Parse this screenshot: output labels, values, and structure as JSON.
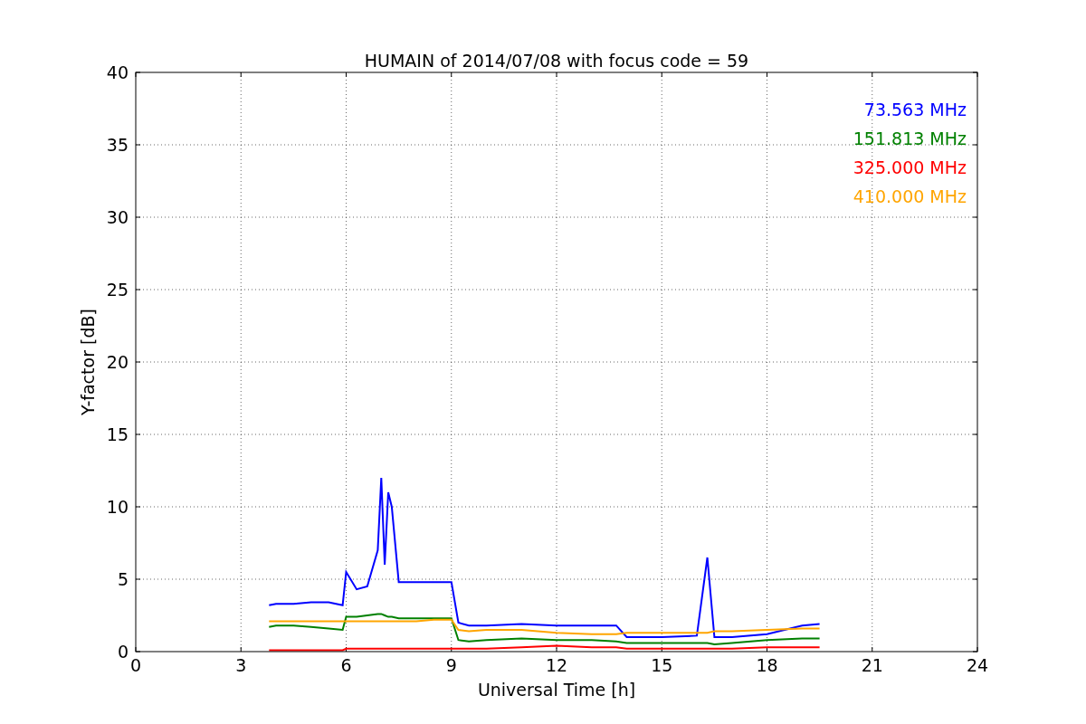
{
  "chart_data": {
    "type": "line",
    "title": "HUMAIN of 2014/07/08 with focus code = 59",
    "xlabel": "Universal Time [h]",
    "ylabel": "Y-factor [dB]",
    "xlim": [
      0,
      24
    ],
    "ylim": [
      0,
      40
    ],
    "grid": true,
    "xticks": [
      0,
      3,
      6,
      9,
      12,
      15,
      18,
      21,
      24
    ],
    "yticks": [
      0,
      5,
      10,
      15,
      20,
      25,
      30,
      35,
      40
    ],
    "x": [
      3.8,
      4,
      4.5,
      5,
      5.5,
      5.9,
      6.0,
      6.3,
      6.6,
      6.9,
      7.0,
      7.1,
      7.2,
      7.3,
      7.5,
      8,
      8.5,
      9,
      9.2,
      9.5,
      10,
      11,
      12,
      13,
      13.7,
      14,
      15,
      16,
      16.3,
      16.5,
      17,
      18,
      19,
      19.5
    ],
    "series": [
      {
        "name": "73.563 MHz",
        "color": "#0000ff",
        "values": [
          3.2,
          3.3,
          3.3,
          3.4,
          3.4,
          3.2,
          5.5,
          4.3,
          4.5,
          7,
          12,
          6,
          11,
          10,
          4.8,
          4.8,
          4.8,
          4.8,
          2.0,
          1.8,
          1.8,
          1.9,
          1.8,
          1.8,
          1.8,
          1.0,
          1.0,
          1.1,
          6.5,
          1.0,
          1.0,
          1.2,
          1.8,
          1.9
        ]
      },
      {
        "name": "151.813 MHz",
        "color": "#008000",
        "values": [
          1.7,
          1.8,
          1.8,
          1.7,
          1.6,
          1.5,
          2.4,
          2.4,
          2.5,
          2.6,
          2.6,
          2.5,
          2.4,
          2.4,
          2.3,
          2.3,
          2.3,
          2.3,
          0.8,
          0.7,
          0.8,
          0.9,
          0.8,
          0.8,
          0.7,
          0.6,
          0.6,
          0.6,
          0.6,
          0.5,
          0.6,
          0.8,
          0.9,
          0.9
        ]
      },
      {
        "name": "325.000 MHz",
        "color": "#ff0000",
        "values": [
          0.1,
          0.1,
          0.1,
          0.1,
          0.1,
          0.1,
          0.2,
          0.2,
          0.2,
          0.2,
          0.2,
          0.2,
          0.2,
          0.2,
          0.2,
          0.2,
          0.2,
          0.2,
          0.2,
          0.2,
          0.2,
          0.3,
          0.4,
          0.3,
          0.3,
          0.2,
          0.2,
          0.2,
          0.2,
          0.2,
          0.2,
          0.3,
          0.3,
          0.3
        ]
      },
      {
        "name": "410.000 MHz",
        "color": "#ffa500",
        "values": [
          2.1,
          2.1,
          2.1,
          2.1,
          2.1,
          2.1,
          2.1,
          2.1,
          2.1,
          2.1,
          2.1,
          2.1,
          2.1,
          2.1,
          2.1,
          2.1,
          2.2,
          2.2,
          1.5,
          1.4,
          1.5,
          1.5,
          1.3,
          1.2,
          1.2,
          1.3,
          1.3,
          1.3,
          1.3,
          1.4,
          1.4,
          1.5,
          1.6,
          1.6
        ]
      }
    ]
  }
}
